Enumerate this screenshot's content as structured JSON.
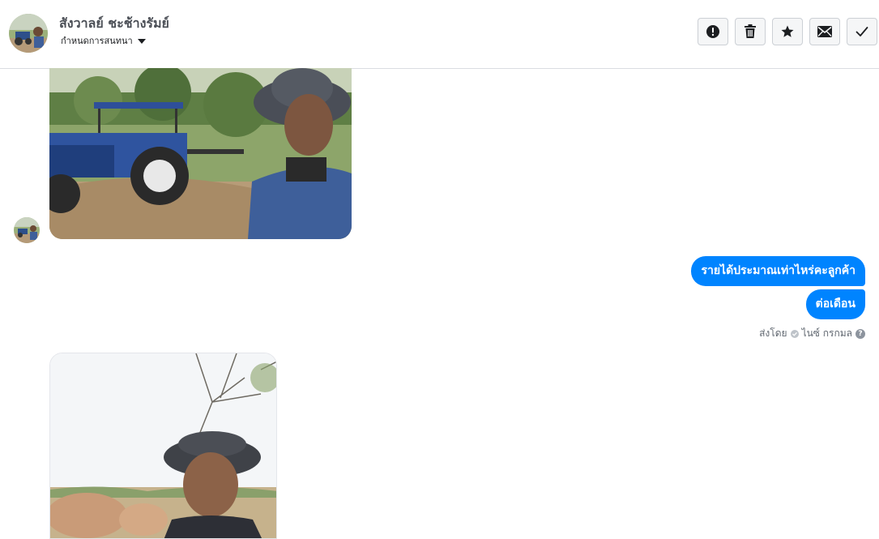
{
  "header": {
    "contact_name": "สังวาลย์ ชะช้างรัมย์",
    "subtitle": "กำหนดการสนทนา"
  },
  "actions": [
    {
      "name": "report-button",
      "icon": "exclamation-icon"
    },
    {
      "name": "delete-button",
      "icon": "trash-icon"
    },
    {
      "name": "star-button",
      "icon": "star-icon"
    },
    {
      "name": "mark-unread-button",
      "icon": "envelope-icon"
    },
    {
      "name": "mark-done-button",
      "icon": "checkmark-icon"
    }
  ],
  "messages": {
    "outgoing": [
      "รายได้ประมาณเท่าไหร่คะลูกค้า",
      "ต่อเดือน"
    ],
    "sent_by_label": "ส่งโดย",
    "sent_by_name": "ไนซ์ กรกมล",
    "help_glyph": "?"
  },
  "colors": {
    "bubble": "#0084ff",
    "header_border": "#dadde1"
  }
}
